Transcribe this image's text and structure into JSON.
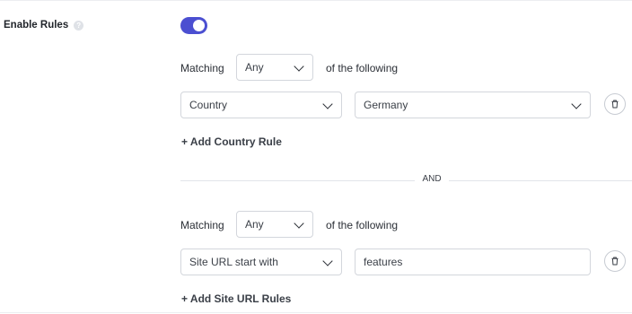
{
  "enable_rules": {
    "label": "Enable Rules",
    "help_icon": "question-circle-icon",
    "toggle_on": true,
    "accent_color": "#4b4fd1"
  },
  "groups": [
    {
      "matching_label": "Matching",
      "matching_value": "Any",
      "of_following": "of the following",
      "rule": {
        "field": "Country",
        "value": "Germany"
      },
      "add_rule_label": "+ Add Country Rule"
    },
    {
      "matching_label": "Matching",
      "matching_value": "Any",
      "of_following": "of the following",
      "rule": {
        "field": "Site URL start with",
        "value": "features"
      },
      "add_rule_label": "+ Add Site URL Rules"
    }
  ],
  "separator_label": "AND"
}
